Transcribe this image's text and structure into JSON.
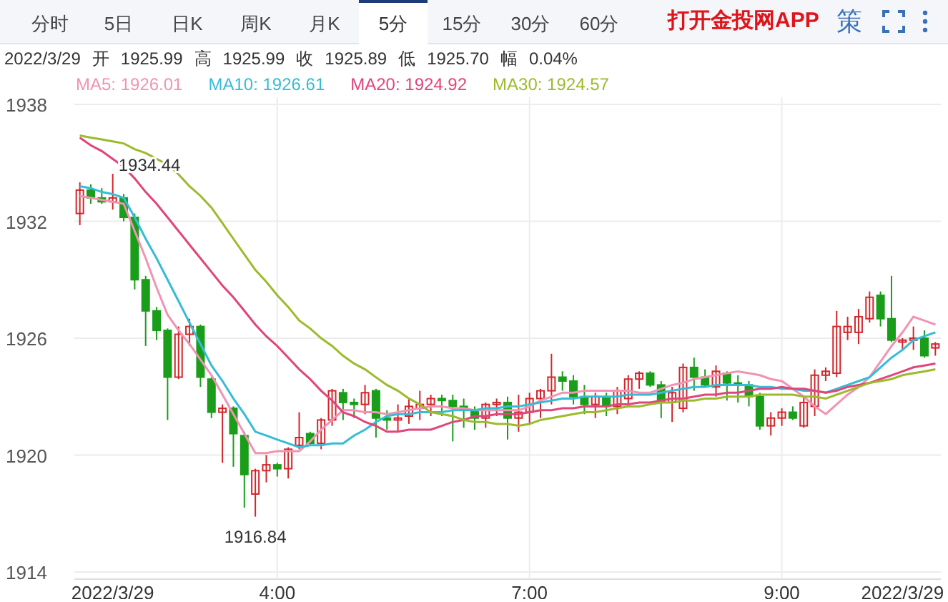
{
  "tabs": [
    {
      "label": "分时",
      "selected": false
    },
    {
      "label": "5日",
      "selected": false
    },
    {
      "label": "日K",
      "selected": false
    },
    {
      "label": "周K",
      "selected": false
    },
    {
      "label": "月K",
      "selected": false
    },
    {
      "label": "5分",
      "selected": true
    },
    {
      "label": "15分",
      "selected": false
    },
    {
      "label": "30分",
      "selected": false
    },
    {
      "label": "60分",
      "selected": false
    }
  ],
  "app_link": "打开金投网APP",
  "strategy_button": "策",
  "quote": {
    "date": "2022/3/29",
    "items": [
      {
        "label": "开",
        "value": "1925.99"
      },
      {
        "label": "高",
        "value": "1925.99"
      },
      {
        "label": "收",
        "value": "1925.89"
      },
      {
        "label": "低",
        "value": "1925.70"
      },
      {
        "label": "幅",
        "value": "0.04%"
      }
    ]
  },
  "legend_separator": ":",
  "ma_legend": [
    {
      "value": "1926.01"
    },
    {
      "value": "1926.61"
    },
    {
      "value": "1924.92"
    },
    {
      "value": "1924.57"
    }
  ],
  "chart": {
    "chart_data": {
      "type": "candlestick",
      "grid": true,
      "categories": [
        null,
        null,
        null,
        "2022/3/29",
        null,
        null,
        null,
        null,
        null,
        null,
        null,
        null,
        null,
        null,
        null,
        null,
        null,
        null,
        "4:00",
        null,
        null,
        null,
        null,
        null,
        null,
        null,
        null,
        null,
        null,
        null,
        null,
        null,
        null,
        null,
        null,
        null,
        null,
        null,
        null,
        null,
        null,
        "7:00",
        null,
        null,
        null,
        null,
        null,
        null,
        null,
        null,
        null,
        null,
        null,
        null,
        null,
        null,
        null,
        null,
        null,
        null,
        null,
        null,
        null,
        null,
        "9:00",
        null,
        null,
        null,
        null,
        null,
        null,
        null,
        null,
        null,
        null,
        "2022/3/29",
        null,
        null,
        null
      ],
      "ylim": [
        1914,
        1938
      ],
      "yticks": [
        1914,
        1920,
        1926,
        1932,
        1938
      ],
      "ohlc": [
        [
          1932.4,
          1934.0,
          1931.8,
          1933.6
        ],
        [
          1933.6,
          1933.9,
          1932.9,
          1933.2
        ],
        [
          1933.2,
          1933.7,
          1932.9,
          1933.0
        ],
        [
          1933.0,
          1934.44,
          1932.6,
          1933.2
        ],
        [
          1933.2,
          1933.4,
          1932.0,
          1932.2
        ],
        [
          1932.2,
          1932.4,
          1928.5,
          1929.0
        ],
        [
          1929.0,
          1929.2,
          1925.6,
          1927.4
        ],
        [
          1927.4,
          1927.6,
          1925.9,
          1926.4
        ],
        [
          1926.4,
          1926.5,
          1921.8,
          1924.0
        ],
        [
          1924.0,
          1926.6,
          1923.9,
          1926.2
        ],
        [
          1926.2,
          1927.0,
          1925.6,
          1926.6
        ],
        [
          1926.6,
          1926.7,
          1923.5,
          1924.0
        ],
        [
          1923.9,
          1924.0,
          1921.9,
          1922.2
        ],
        [
          1922.2,
          1922.6,
          1919.6,
          1922.4
        ],
        [
          1922.4,
          1922.5,
          1919.4,
          1921.1
        ],
        [
          1921.0,
          1921.2,
          1917.3,
          1919.0
        ],
        [
          1918.0,
          1919.3,
          1916.84,
          1919.2
        ],
        [
          1919.2,
          1920.0,
          1918.6,
          1919.5
        ],
        [
          1919.5,
          1919.6,
          1918.9,
          1919.3
        ],
        [
          1919.3,
          1920.4,
          1918.8,
          1920.3
        ],
        [
          1920.5,
          1922.2,
          1920.3,
          1920.9
        ],
        [
          1921.1,
          1921.2,
          1920.5,
          1920.6
        ],
        [
          1920.6,
          1921.9,
          1920.3,
          1921.8
        ],
        [
          1921.8,
          1923.4,
          1921.5,
          1923.3
        ],
        [
          1923.2,
          1923.4,
          1921.8,
          1922.7
        ],
        [
          1922.7,
          1922.9,
          1921.9,
          1922.6
        ],
        [
          1922.6,
          1923.6,
          1922.1,
          1923.2
        ],
        [
          1923.3,
          1923.4,
          1920.9,
          1921.9
        ],
        [
          1921.9,
          1922.3,
          1921.3,
          1921.8
        ],
        [
          1921.8,
          1922.6,
          1921.2,
          1921.9
        ],
        [
          1922.0,
          1922.9,
          1921.6,
          1922.5
        ],
        [
          1922.4,
          1923.3,
          1921.8,
          1922.6
        ],
        [
          1922.6,
          1923.1,
          1922.0,
          1922.9
        ],
        [
          1922.9,
          1923.1,
          1922.0,
          1922.8
        ],
        [
          1922.8,
          1923.1,
          1920.7,
          1922.5
        ],
        [
          1922.5,
          1922.9,
          1921.4,
          1922.3
        ],
        [
          1922.3,
          1922.5,
          1921.3,
          1921.9
        ],
        [
          1921.9,
          1922.7,
          1921.4,
          1922.6
        ],
        [
          1922.6,
          1922.9,
          1922.0,
          1922.7
        ],
        [
          1922.7,
          1923.0,
          1920.8,
          1921.9
        ],
        [
          1921.9,
          1923.1,
          1921.2,
          1922.2
        ],
        [
          1922.2,
          1923.2,
          1921.6,
          1922.9
        ],
        [
          1922.9,
          1923.4,
          1921.9,
          1923.3
        ],
        [
          1923.3,
          1925.2,
          1922.6,
          1924.0
        ],
        [
          1924.0,
          1924.3,
          1923.3,
          1923.8
        ],
        [
          1923.8,
          1924.1,
          1922.6,
          1923.0
        ],
        [
          1923.0,
          1923.6,
          1922.1,
          1922.6
        ],
        [
          1922.6,
          1923.2,
          1921.9,
          1923.0
        ],
        [
          1923.0,
          1923.2,
          1922.0,
          1922.5
        ],
        [
          1922.5,
          1923.5,
          1922.1,
          1923.3
        ],
        [
          1922.9,
          1924.1,
          1922.6,
          1923.9
        ],
        [
          1923.9,
          1924.3,
          1923.4,
          1924.2
        ],
        [
          1924.2,
          1924.3,
          1923.5,
          1923.6
        ],
        [
          1923.6,
          1923.8,
          1921.9,
          1922.7
        ],
        [
          1922.7,
          1923.5,
          1921.7,
          1923.2
        ],
        [
          1922.4,
          1924.7,
          1922.2,
          1924.5
        ],
        [
          1924.5,
          1925.0,
          1923.3,
          1924.0
        ],
        [
          1924.0,
          1924.4,
          1923.5,
          1923.6
        ],
        [
          1923.5,
          1924.6,
          1923.0,
          1924.3
        ],
        [
          1924.2,
          1924.3,
          1922.8,
          1923.7
        ],
        [
          1923.7,
          1924.1,
          1922.7,
          1923.6
        ],
        [
          1923.6,
          1923.8,
          1922.5,
          1923.0
        ],
        [
          1923.0,
          1923.2,
          1921.3,
          1921.5
        ],
        [
          1921.5,
          1922.2,
          1921.0,
          1921.9
        ],
        [
          1921.9,
          1922.4,
          1921.5,
          1922.2
        ],
        [
          1922.2,
          1922.5,
          1921.8,
          1921.9
        ],
        [
          1921.5,
          1923.0,
          1921.4,
          1922.7
        ],
        [
          1922.5,
          1924.4,
          1922.0,
          1924.1
        ],
        [
          1924.1,
          1924.5,
          1923.8,
          1924.3
        ],
        [
          1924.2,
          1927.4,
          1924.0,
          1926.6
        ],
        [
          1926.3,
          1927.1,
          1925.9,
          1926.6
        ],
        [
          1926.3,
          1927.5,
          1925.7,
          1927.1
        ],
        [
          1927.0,
          1928.4,
          1926.8,
          1928.1
        ],
        [
          1928.2,
          1928.4,
          1926.6,
          1927.0
        ],
        [
          1927.0,
          1929.2,
          1925.8,
          1925.9
        ],
        [
          1925.8,
          1926.0,
          1925.4,
          1925.9
        ],
        [
          1925.9,
          1926.6,
          1925.4,
          1926.0
        ],
        [
          1926.0,
          1926.4,
          1925.0,
          1925.1
        ],
        [
          1925.5,
          1925.8,
          1925.1,
          1925.7
        ]
      ],
      "series": [
        {
          "name": "MA5",
          "type": "line",
          "color": "#f293b4",
          "values": [
            1933.3,
            1933.2,
            1933.1,
            1933.0,
            1932.9,
            1931.5,
            1930.1,
            1928.6,
            1927.2,
            1926.4,
            1925.7,
            1924.9,
            1924.1,
            1923.1,
            1922.1,
            1921.1,
            1920.1,
            1920.1,
            1920.2,
            1920.2,
            1920.2,
            1920.7,
            1921.3,
            1921.8,
            1922.3,
            1922.3,
            1922.2,
            1922.2,
            1922.1,
            1922.2,
            1922.3,
            1922.4,
            1922.5,
            1922.5,
            1922.4,
            1922.4,
            1922.3,
            1922.3,
            1922.3,
            1922.3,
            1922.3,
            1922.5,
            1922.8,
            1923.0,
            1923.2,
            1923.2,
            1923.3,
            1923.3,
            1923.3,
            1923.3,
            1923.3,
            1923.2,
            1923.2,
            1923.4,
            1923.6,
            1923.7,
            1923.9,
            1924.0,
            1924.1,
            1924.2,
            1924.3,
            1924.2,
            1924.1,
            1923.9,
            1923.8,
            1923.4,
            1923.0,
            1922.5,
            1922.1,
            1922.6,
            1923.1,
            1923.5,
            1924.0,
            1924.8,
            1925.6,
            1926.3,
            1927.1,
            1926.9,
            1926.7
          ]
        },
        {
          "name": "MA10",
          "type": "line",
          "color": "#36bcd6",
          "values": [
            1933.8,
            1933.7,
            1933.5,
            1933.4,
            1933.2,
            1932.2,
            1931.1,
            1930.1,
            1929.0,
            1927.9,
            1926.8,
            1925.7,
            1924.6,
            1923.8,
            1922.9,
            1922.1,
            1921.2,
            1921.0,
            1920.8,
            1920.6,
            1920.4,
            1920.5,
            1920.5,
            1920.6,
            1920.6,
            1921.0,
            1921.3,
            1921.7,
            1922.0,
            1922.1,
            1922.1,
            1922.2,
            1922.2,
            1922.2,
            1922.3,
            1922.3,
            1922.3,
            1922.4,
            1922.4,
            1922.5,
            1922.5,
            1922.6,
            1922.7,
            1922.8,
            1922.9,
            1922.9,
            1923.0,
            1923.0,
            1923.0,
            1923.0,
            1923.1,
            1923.1,
            1923.1,
            1923.2,
            1923.3,
            1923.4,
            1923.5,
            1923.5,
            1923.6,
            1923.6,
            1923.6,
            1923.6,
            1923.5,
            1923.5,
            1923.4,
            1923.4,
            1923.3,
            1923.3,
            1923.2,
            1923.4,
            1923.6,
            1923.8,
            1924.0,
            1924.5,
            1925.0,
            1925.4,
            1925.9,
            1926.1,
            1926.3
          ]
        },
        {
          "name": "MA20",
          "type": "line",
          "color": "#e0457b",
          "values": [
            1936.3,
            1935.9,
            1935.6,
            1935.2,
            1934.8,
            1934.2,
            1933.5,
            1932.9,
            1932.2,
            1931.5,
            1930.8,
            1930.1,
            1929.4,
            1928.7,
            1928.1,
            1927.4,
            1926.7,
            1926.1,
            1925.6,
            1925.0,
            1924.4,
            1923.9,
            1923.3,
            1922.8,
            1922.2,
            1922.0,
            1921.7,
            1921.5,
            1921.2,
            1921.2,
            1921.3,
            1921.3,
            1921.3,
            1921.5,
            1921.7,
            1921.8,
            1922.0,
            1922.0,
            1922.1,
            1922.1,
            1922.1,
            1922.2,
            1922.3,
            1922.3,
            1922.4,
            1922.4,
            1922.5,
            1922.5,
            1922.5,
            1922.6,
            1922.6,
            1922.7,
            1922.7,
            1922.8,
            1922.9,
            1922.9,
            1923.0,
            1923.1,
            1923.1,
            1923.2,
            1923.2,
            1923.3,
            1923.4,
            1923.4,
            1923.5,
            1923.4,
            1923.4,
            1923.3,
            1923.2,
            1923.3,
            1923.5,
            1923.6,
            1923.7,
            1923.9,
            1924.1,
            1924.3,
            1924.5,
            1924.6,
            1924.7
          ]
        },
        {
          "name": "MA30",
          "type": "line",
          "color": "#9cbb2c",
          "values": [
            1936.4,
            1936.3,
            1936.2,
            1936.1,
            1936.0,
            1935.7,
            1935.5,
            1935.2,
            1934.9,
            1934.4,
            1933.8,
            1933.3,
            1932.7,
            1931.9,
            1931.1,
            1930.3,
            1929.5,
            1928.9,
            1928.2,
            1927.6,
            1926.9,
            1926.5,
            1926.0,
            1925.6,
            1925.1,
            1924.7,
            1924.4,
            1924.0,
            1923.6,
            1923.3,
            1922.9,
            1922.6,
            1922.2,
            1922.1,
            1922.0,
            1921.8,
            1921.7,
            1921.7,
            1921.6,
            1921.6,
            1921.5,
            1921.6,
            1921.8,
            1921.9,
            1922.0,
            1922.1,
            1922.2,
            1922.2,
            1922.3,
            1922.4,
            1922.5,
            1922.5,
            1922.6,
            1922.7,
            1922.7,
            1922.8,
            1922.8,
            1922.9,
            1922.9,
            1923.0,
            1923.0,
            1923.0,
            1923.1,
            1923.1,
            1923.1,
            1923.1,
            1923.0,
            1923.0,
            1922.9,
            1923.1,
            1923.3,
            1923.5,
            1923.7,
            1923.8,
            1923.9,
            1924.1,
            1924.2,
            1924.3,
            1924.4
          ]
        }
      ],
      "annotations": [
        "1934.44",
        "1916.84"
      ]
    }
  }
}
